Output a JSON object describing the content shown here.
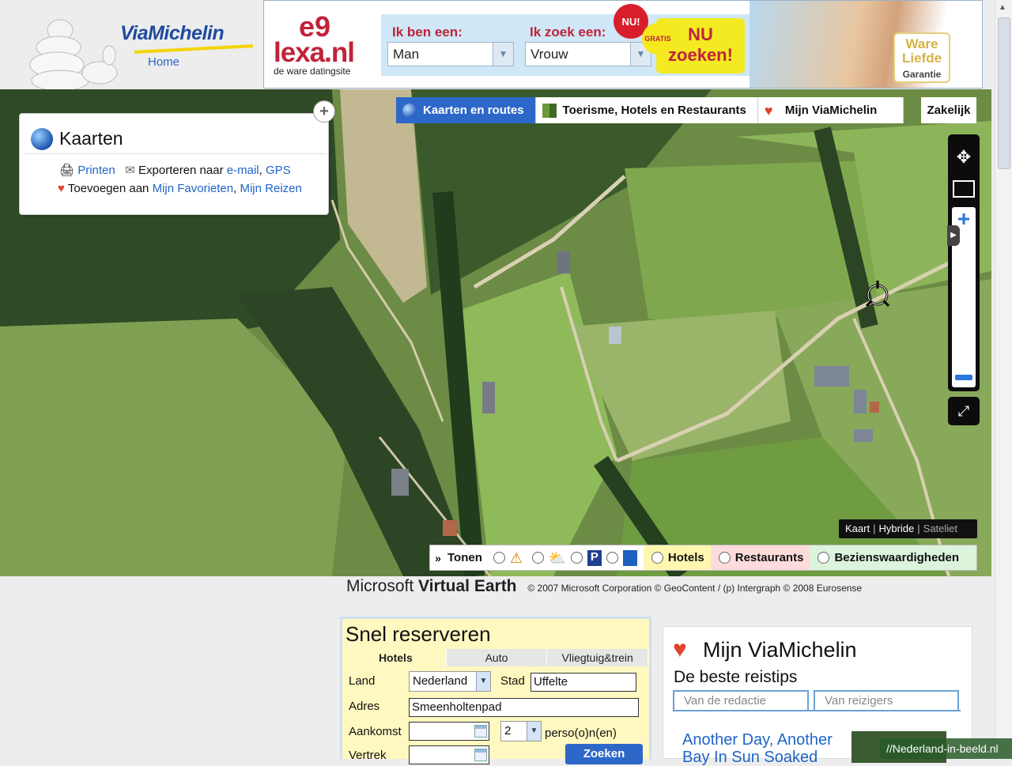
{
  "header": {
    "brand": "ViaMichelin",
    "home_link": "Home"
  },
  "ad": {
    "logo_mark": "e9",
    "logo_name": "lexa.nl",
    "tagline": "de ware datingsite",
    "label_i_am": "Ik ben een:",
    "label_seek": "Ik zoek een:",
    "select_i_am": "Man",
    "select_seek": "Vrouw",
    "badge_try": "NU!",
    "badge_free": "GRATIS",
    "cta_line1": "NU",
    "cta_line2": "zoeken!",
    "guarantee_line1": "Ware",
    "guarantee_line2": "Liefde",
    "guarantee_line3": "Garantie"
  },
  "nav_tabs": [
    {
      "label": "Kaarten en routes",
      "active": true
    },
    {
      "label": "Toerisme, Hotels en Restaurants",
      "active": false
    },
    {
      "label": "Mijn ViaMichelin",
      "active": false
    }
  ],
  "nav_business": "Zakelijk",
  "kaarten_panel": {
    "title": "Kaarten",
    "print": "Printen",
    "export_prefix": "Exporteren naar",
    "export_email": "e-mail",
    "export_gps": "GPS",
    "add_prefix": "Toevoegen aan",
    "add_favorites": "Mijn Favorieten",
    "add_trips": "Mijn Reizen"
  },
  "view_modes": {
    "map": "Kaart",
    "hybrid": "Hybride",
    "satellite": "Sateliet"
  },
  "poi_bar": {
    "toggle_label": "Tonen",
    "hotels": "Hotels",
    "restaurants": "Restaurants",
    "sights": "Bezienswaardigheden"
  },
  "credit": {
    "brand_a": "Microsoft",
    "brand_b": "Virtual Earth",
    "copyright": "© 2007 Microsoft Corporation © GeoContent / (p) Intergraph © 2008 Eurosense"
  },
  "booking": {
    "title": "Snel reserveren",
    "tabs": [
      "Hotels",
      "Auto",
      "Vliegtuig&trein"
    ],
    "label_country": "Land",
    "country": "Nederland",
    "label_city": "Stad",
    "city": "Uffelte",
    "label_address": "Adres",
    "address": "Smeenholtenpad",
    "label_arrival": "Aankomst",
    "persons": "2",
    "persons_label": "perso(o)n(en)",
    "label_departure": "Vertrek",
    "search_button": "Zoeken"
  },
  "my_viamichelin": {
    "title": "Mijn ViaMichelin",
    "subtitle": "De beste reistips",
    "tab_editors": "Van de redactie",
    "tab_travelers": "Van reizigers",
    "article_title": "Another Day, Another Bay In Sun Soaked"
  },
  "watermark": "//Nederland-in-beeld.nl"
}
